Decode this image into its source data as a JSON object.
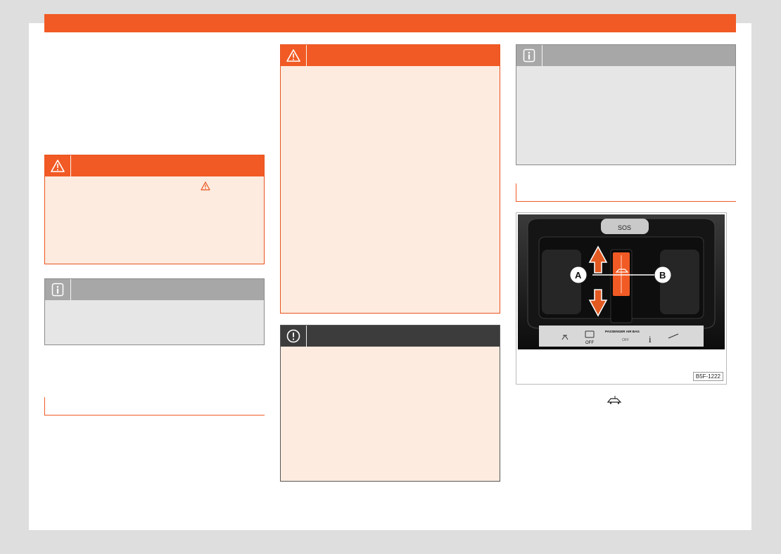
{
  "colors": {
    "accent": "#f15a24",
    "warning_body": "#fdebdf",
    "info_head": "#a7a7a7",
    "notice_head": "#3c3c3c"
  },
  "icons": {
    "warning": "warning-triangle-icon",
    "info": "info-icon",
    "notice": "exclamation-circle-icon",
    "vehicle": "car-profile-icon"
  },
  "figure": {
    "sos_label": "SOS",
    "callout_a": "A",
    "callout_b": "B",
    "panel_off_label": "OFF",
    "panel_airbag_label": "PASSENGER AIR BAG",
    "panel_off_small": "OFF",
    "panel_info_symbol": "i",
    "code": "B5F-1222"
  }
}
